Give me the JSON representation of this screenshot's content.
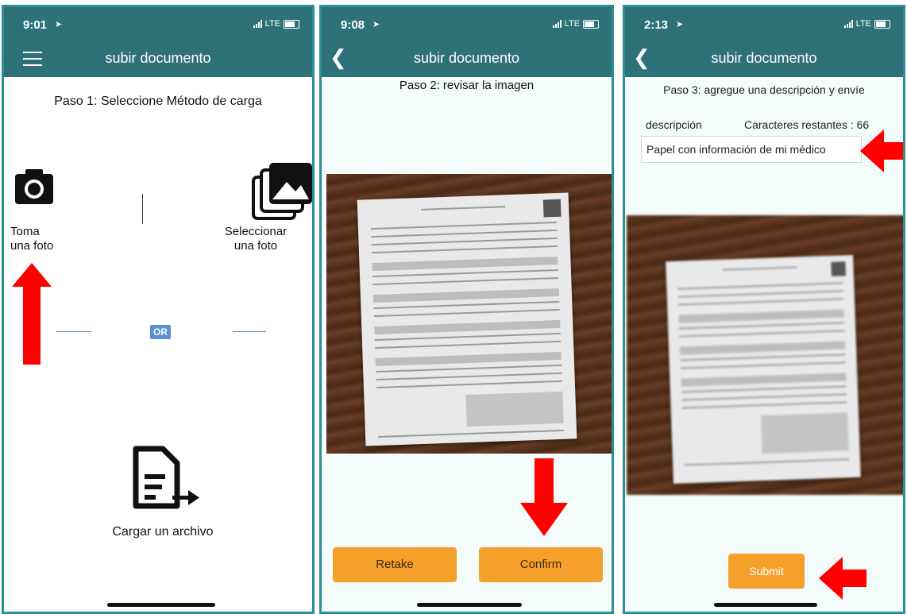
{
  "screens": [
    {
      "time": "9:01",
      "network": "LTE",
      "header_title": "subir documento",
      "step": "Paso 1: Seleccione Método de carga",
      "take_photo_label_1": "Toma",
      "take_photo_label_2": "una foto",
      "select_photo_label_1": "Seleccionar",
      "select_photo_label_2": "una foto",
      "or_label": "OR",
      "upload_file_label": "Cargar un archivo"
    },
    {
      "time": "9:08",
      "network": "LTE",
      "header_title": "subir documento",
      "step": "Paso 2: revisar la imagen",
      "retake_label": "Retake",
      "confirm_label": "Confirm"
    },
    {
      "time": "2:13",
      "network": "LTE",
      "header_title": "subir documento",
      "step": "Paso 3: agregue una descripción y envíe",
      "description_label": "descripción",
      "remaining_label": "Caracteres restantes : 66",
      "description_value": "Papel con información de mi médico",
      "submit_label": "Submit"
    }
  ],
  "colors": {
    "header": "#2e7178",
    "frame": "#2b8f95",
    "button": "#f5a02a",
    "annotation_arrow": "#ff0000"
  }
}
